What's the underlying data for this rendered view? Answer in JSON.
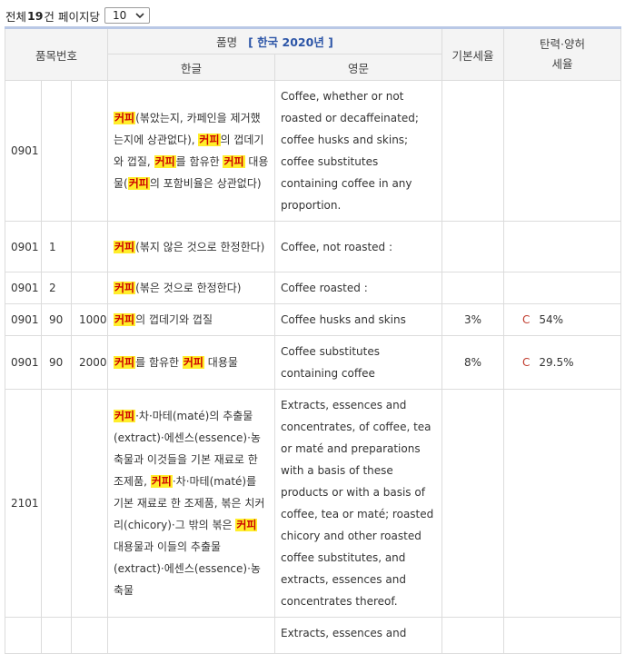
{
  "toolbar": {
    "total_prefix": "전체",
    "total_count": "19",
    "total_suffix": "건",
    "per_page_label": "페이지당",
    "per_page_value": "10"
  },
  "header": {
    "code_col": "품목번호",
    "name_col": "품명",
    "name_bracket_text": "[ 한국  2020년 ]",
    "korean_col": "한글",
    "english_col": "영문",
    "base_rate_col": "기본세율",
    "elastic_rate_col_line1": "탄력·양허",
    "elastic_rate_col_line2": "세율"
  },
  "keyword": "커피",
  "rows": [
    {
      "code": "0901",
      "sub1": "",
      "sub2": "",
      "ko": [
        "[커피]",
        "(볶았는지, 카페인을 제거했는지에 상관없다), ",
        "[커피]",
        "의 껍데기와 껍질, ",
        "[커피]",
        "를 함유한 ",
        "[커피]",
        " 대용물(",
        "[커피]",
        "의 포함비율은 상관없다)"
      ],
      "en": "Coffee, whether or not roasted or decaffeinated; coffee husks and skins; coffee substitutes containing coffee in any proportion.",
      "base": "",
      "elastic_mark": "",
      "elastic_rate": ""
    },
    {
      "code": "0901",
      "sub1": "1",
      "sub2": "",
      "ko": [
        "[커피]",
        "(볶지 않은 것으로 한정한다)"
      ],
      "en": "Coffee, not roasted :",
      "base": "",
      "elastic_mark": "",
      "elastic_rate": ""
    },
    {
      "code": "0901",
      "sub1": "2",
      "sub2": "",
      "ko": [
        "[커피]",
        "(볶은 것으로 한정한다)"
      ],
      "en": "Coffee roasted :",
      "base": "",
      "elastic_mark": "",
      "elastic_rate": ""
    },
    {
      "code": "0901",
      "sub1": "90",
      "sub2": "1000",
      "ko": [
        "[커피]",
        "의 껍데기와 껍질"
      ],
      "en": "Coffee husks and skins",
      "base": "3%",
      "elastic_mark": "C",
      "elastic_rate": "54%"
    },
    {
      "code": "0901",
      "sub1": "90",
      "sub2": "2000",
      "ko": [
        "[커피]",
        "를 함유한 ",
        "[커피]",
        " 대용물"
      ],
      "en": "Coffee substitutes containing coffee",
      "base": "8%",
      "elastic_mark": "C",
      "elastic_rate": "29.5%"
    },
    {
      "code": "2101",
      "sub1": "",
      "sub2": "",
      "ko": [
        "[커피]",
        "·차·마테(maté)의 추출물(extract)·에센스(essence)·농축물과 이것들을 기본 재료로 한 조제품, ",
        "[커피]",
        "·차·마테(maté)를 기본 재료로 한 조제품, 볶은 치커리(chicory)·그 밖의 볶은 ",
        "[커피]",
        " 대용물과 이들의 추출물(extract)·에센스(essence)·농축물"
      ],
      "en": "Extracts, essences and concentrates, of coffee, tea or maté and preparations with a basis of these products or with a basis of coffee, tea or maté; roasted chicory and other roasted coffee substitutes, and extracts, essences and concentrates thereof.",
      "base": "",
      "elastic_mark": "",
      "elastic_rate": ""
    },
    {
      "code": "",
      "sub1": "",
      "sub2": "",
      "ko": [],
      "en": "Extracts, essences and",
      "base": "",
      "elastic_mark": "",
      "elastic_rate": ""
    }
  ]
}
